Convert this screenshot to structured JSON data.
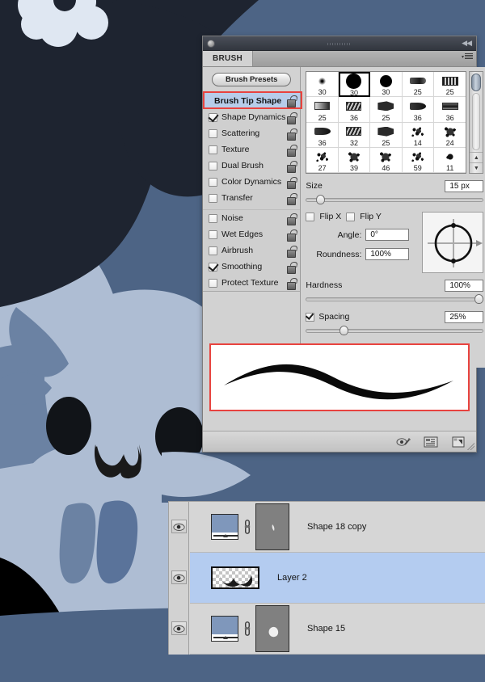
{
  "app": {
    "artwork_colors": {
      "canvas_blue": "#4d6485",
      "dark_navy": "#1e2430",
      "body_light": "#aebdd3",
      "body_mid": "#9bb0cc",
      "shadow_blue": "#6b82a3",
      "tooth_blue": "#5a739a",
      "flower_white": "#dfe7f2",
      "eye_black": "#111418"
    },
    "accent_red": "#e8433f",
    "selection_blue": "#b4ccf0",
    "header_blue": "#b7cdea"
  },
  "brush_panel": {
    "titlebar": {
      "collapse_icon": "collapse-double-arrow-icon"
    },
    "tab": {
      "label": "BRUSH",
      "menu_icon": "panel-menu-icon"
    },
    "presets_button": {
      "label": "Brush Presets"
    },
    "options": [
      {
        "label": "Brush Tip Shape",
        "type": "header",
        "checked": null,
        "selected": true,
        "lock": "unlocked"
      },
      {
        "label": "Shape Dynamics",
        "type": "item",
        "checked": true,
        "highlighted": true,
        "lock": "unlocked"
      },
      {
        "label": "Scattering",
        "type": "item",
        "checked": false,
        "lock": "unlocked"
      },
      {
        "label": "Texture",
        "type": "item",
        "checked": false,
        "lock": "unlocked"
      },
      {
        "label": "Dual Brush",
        "type": "item",
        "checked": false,
        "lock": "unlocked"
      },
      {
        "label": "Color Dynamics",
        "type": "item",
        "checked": false,
        "lock": "unlocked"
      },
      {
        "label": "Transfer",
        "type": "item",
        "checked": false,
        "lock": "unlocked"
      },
      {
        "label": "Noise",
        "type": "item",
        "checked": false,
        "lock": "unlocked"
      },
      {
        "label": "Wet Edges",
        "type": "item",
        "checked": false,
        "lock": "unlocked"
      },
      {
        "label": "Airbrush",
        "type": "item",
        "checked": false,
        "lock": "unlocked"
      },
      {
        "label": "Smoothing",
        "type": "item",
        "checked": true,
        "lock": "unlocked"
      },
      {
        "label": "Protect Texture",
        "type": "item",
        "checked": false,
        "lock": "unlocked"
      }
    ],
    "presets": {
      "rows": [
        [
          {
            "size": "30",
            "tip": "tip-soft",
            "selected": false
          },
          {
            "size": "30",
            "tip": "tip-hard",
            "selected": true
          },
          {
            "size": "30",
            "tip": "tip-hard2",
            "selected": false
          },
          {
            "size": "25",
            "tip": "tip-flat",
            "selected": false
          },
          {
            "size": "25",
            "tip": "tip-brist",
            "selected": false
          }
        ],
        [
          {
            "size": "25",
            "tip": "tip-chis",
            "selected": false
          },
          {
            "size": "36",
            "tip": "tip-slant",
            "selected": false
          },
          {
            "size": "25",
            "tip": "tip-fan",
            "selected": false
          },
          {
            "size": "36",
            "tip": "tip-round",
            "selected": false
          },
          {
            "size": "36",
            "tip": "tip-wide",
            "selected": false
          }
        ],
        [
          {
            "size": "36",
            "tip": "tip-round",
            "selected": false
          },
          {
            "size": "32",
            "tip": "tip-slant",
            "selected": false
          },
          {
            "size": "25",
            "tip": "tip-fan",
            "selected": false
          },
          {
            "size": "14",
            "tip": "tip-spat1",
            "selected": false
          },
          {
            "size": "24",
            "tip": "tip-spat2",
            "selected": false
          }
        ],
        [
          {
            "size": "27",
            "tip": "tip-spat1",
            "selected": false
          },
          {
            "size": "39",
            "tip": "tip-spat2",
            "selected": false
          },
          {
            "size": "46",
            "tip": "tip-spat2",
            "selected": false
          },
          {
            "size": "59",
            "tip": "tip-spat1",
            "selected": false
          },
          {
            "size": "11",
            "tip": "tip-tiny",
            "selected": false
          }
        ]
      ],
      "scrollbar": {
        "thumb_position_pct": 0,
        "up_arrow": "▲",
        "down_arrow": "▼"
      }
    },
    "controls": {
      "size": {
        "label": "Size",
        "value": "15 px",
        "slider_pct": 6
      },
      "flip_x": {
        "label": "Flip X",
        "checked": false
      },
      "flip_y": {
        "label": "Flip Y",
        "checked": false
      },
      "angle": {
        "label": "Angle:",
        "value": "0°"
      },
      "roundness": {
        "label": "Roundness:",
        "value": "100%"
      },
      "hardness": {
        "label": "Hardness",
        "value": "100%",
        "slider_pct": 100
      },
      "spacing": {
        "label": "Spacing",
        "value": "25%",
        "slider_pct": 20,
        "checked": true
      }
    },
    "preview": {
      "name": "brush-stroke-preview",
      "stroke_shape": "s-curve-tapered"
    },
    "footer_icons": [
      {
        "name": "toggle-brush-preview-icon"
      },
      {
        "name": "preset-manager-icon"
      },
      {
        "name": "new-brush-preset-icon"
      }
    ]
  },
  "layers_panel": {
    "layers": [
      {
        "name": "Shape 18 copy",
        "visible": true,
        "selected": false,
        "has_mask": true,
        "thumb": "shape",
        "linked": true
      },
      {
        "name": "Layer 2",
        "visible": true,
        "selected": true,
        "has_mask": false,
        "thumb": "transparent-stroke",
        "linked": false
      },
      {
        "name": "Shape 15",
        "visible": true,
        "selected": false,
        "has_mask": true,
        "thumb": "shape",
        "linked": true
      }
    ]
  }
}
